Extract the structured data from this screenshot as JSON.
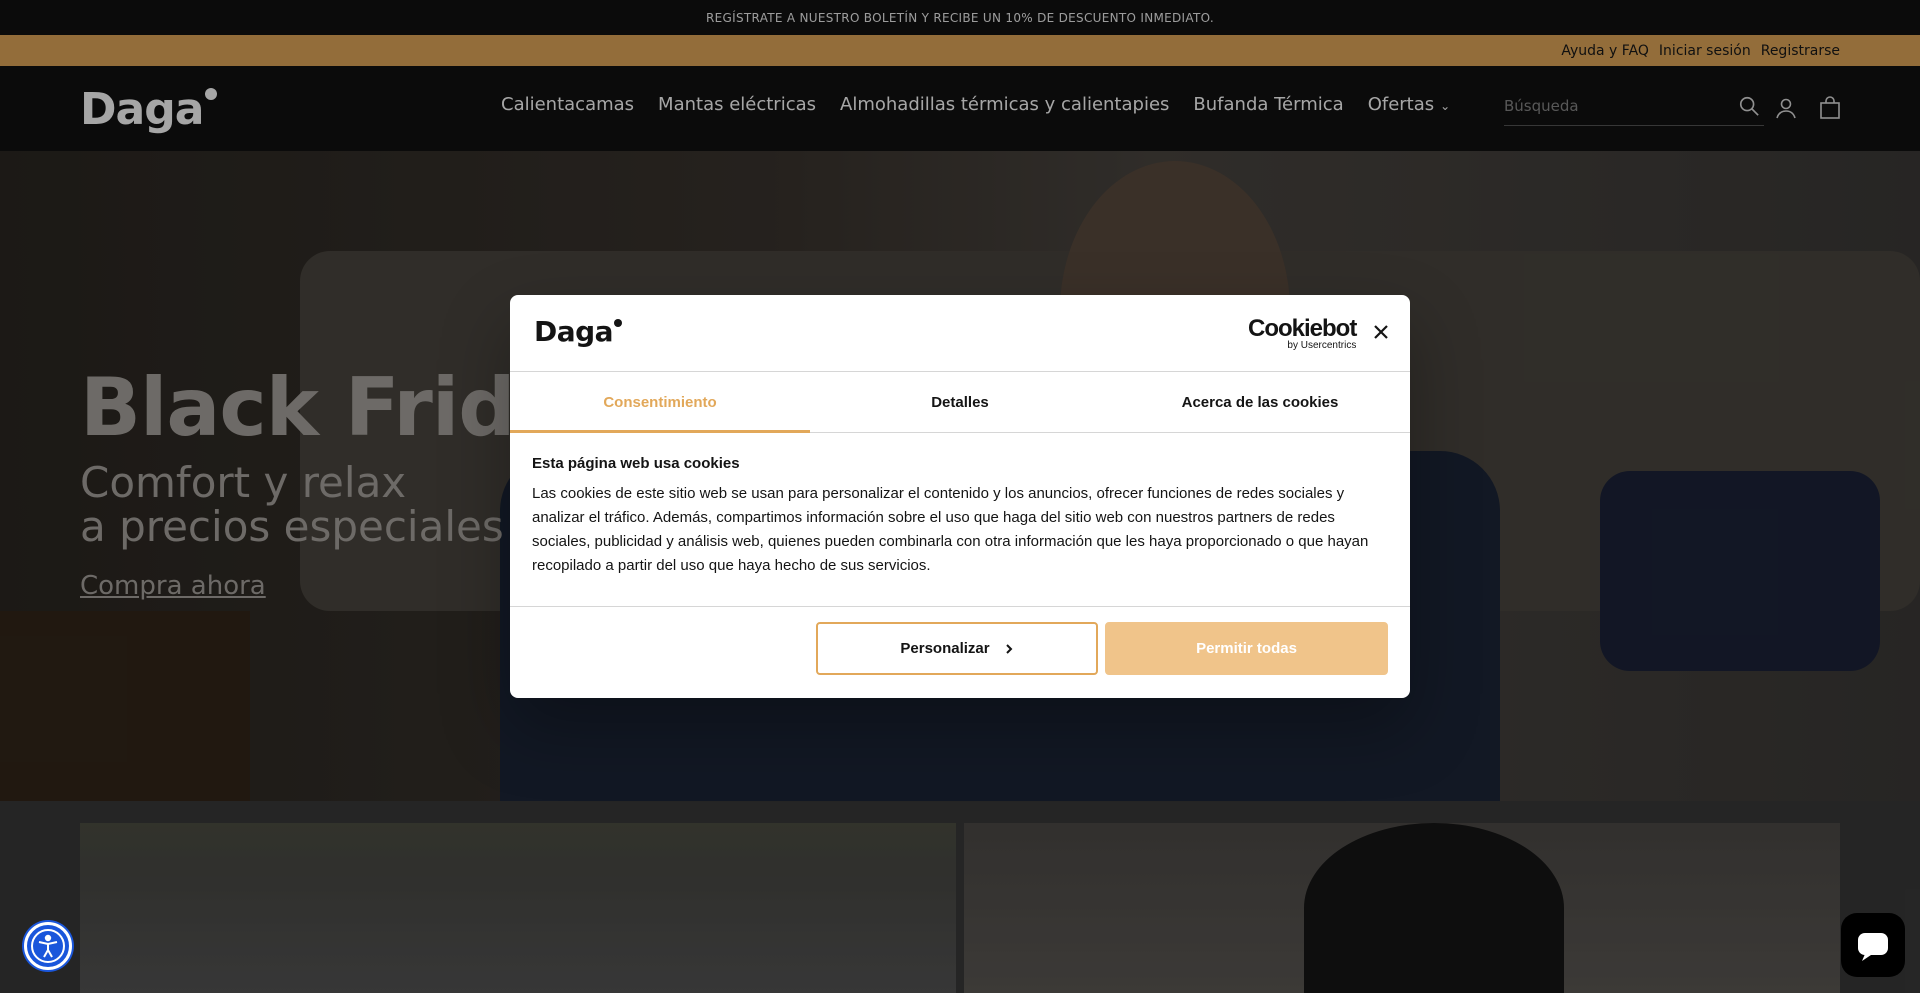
{
  "announcement": "REGÍSTRATE A NUESTRO BOLETÍN Y RECIBE UN 10% DE DESCUENTO INMEDIATO.",
  "utility": {
    "help": "Ayuda y FAQ",
    "login": "Iniciar sesión",
    "register": "Registrarse"
  },
  "brand": {
    "name": "Daga"
  },
  "nav": {
    "items": [
      "Calientacamas",
      "Mantas eléctricas",
      "Almohadillas térmicas y calientapies",
      "Bufanda Térmica",
      "Ofertas"
    ]
  },
  "search": {
    "placeholder": "Búsqueda"
  },
  "hero": {
    "title": "Black Friday",
    "subtitle_line1": "Comfort y relax",
    "subtitle_line2": "a precios especiales",
    "cta": "Compra ahora"
  },
  "cookie": {
    "brand": "Daga",
    "provider": "Cookiebot",
    "provider_sub": "by Usercentrics",
    "tabs": [
      "Consentimiento",
      "Detalles",
      "Acerca de las cookies"
    ],
    "heading": "Esta página web usa cookies",
    "text": "Las cookies de este sitio web se usan para personalizar el contenido y los anuncios, ofrecer funciones de redes sociales y analizar el tráfico. Además, compartimos información sobre el uso que haga del sitio web con nuestros partners de redes sociales, publicidad y análisis web, quienes pueden combinarla con otra información que les haya proporcionado o que hayan recopilado a partir del uso que haya hecho de sus servicios.",
    "customize": "Personalizar",
    "allow_all": "Permitir todas"
  },
  "colors": {
    "accent": "#e2a85a",
    "header": "#121212",
    "allow_button": "#f0c48a"
  }
}
